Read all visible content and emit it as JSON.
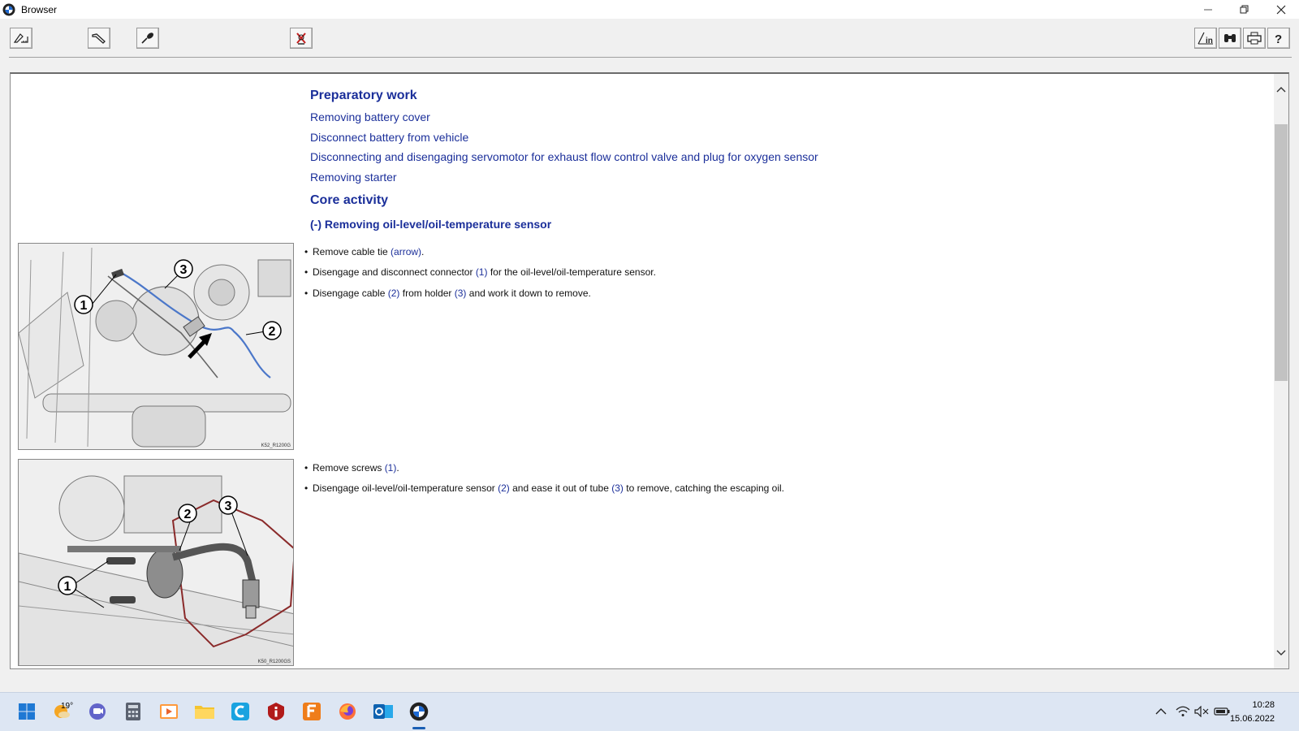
{
  "window": {
    "title": "Browser"
  },
  "document": {
    "preparatory_heading": "Preparatory work",
    "preparatory_links": [
      "Removing battery cover",
      "Disconnect battery from vehicle",
      "Disconnecting and disengaging servomotor for exhaust flow control valve and plug for oxygen sensor",
      "Removing starter"
    ],
    "core_heading": "Core activity",
    "core_subheading": "(-) Removing oil-level/oil-temperature sensor",
    "figure1": {
      "caption": "K52_R1200G",
      "callouts": [
        "1",
        "2",
        "3"
      ],
      "steps": [
        {
          "text_before": "Remove cable tie ",
          "ref": "(arrow)",
          "text_after": "."
        },
        {
          "text_before": "Disengage and disconnect connector ",
          "ref": "(1)",
          "text_after": " for the oil-level/oil-temperature sensor."
        },
        {
          "text_before": "Disengage cable ",
          "ref": "(2)",
          "text_mid": " from holder ",
          "ref2": "(3)",
          "text_after": " and work it down to remove."
        }
      ]
    },
    "figure2": {
      "caption": "K50_R1200GS",
      "callouts": [
        "1",
        "2",
        "3"
      ],
      "steps": [
        {
          "text_before": "Remove screws ",
          "ref": "(1)",
          "text_after": "."
        },
        {
          "text_before": "Disengage oil-level/oil-temperature sensor ",
          "ref": "(2)",
          "text_mid": " and ease it out of tube ",
          "ref2": "(3)",
          "text_after": " to remove, catching the escaping oil."
        }
      ]
    }
  },
  "taskbar": {
    "weather_temp": "19°",
    "time": "10:28",
    "date": "15.06.2022"
  },
  "colors": {
    "link_blue": "#1b2f9a",
    "taskbar_bg": "#dde6f3"
  }
}
